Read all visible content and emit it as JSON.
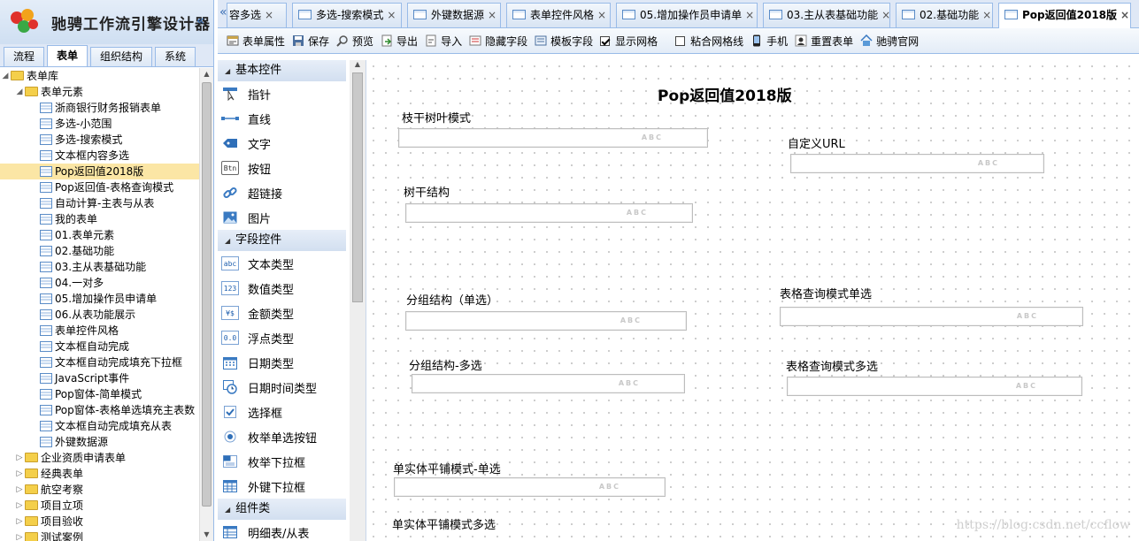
{
  "app": {
    "title": "驰骋工作流引擎设计器",
    "collapse_icon": "«"
  },
  "left_tabs": [
    {
      "label": "流程",
      "active": false
    },
    {
      "label": "表单",
      "active": true
    },
    {
      "label": "组织结构",
      "active": false
    },
    {
      "label": "系统",
      "active": false
    }
  ],
  "tree": {
    "root": "表单库",
    "group": "表单元素",
    "forms": [
      "浙商银行财务报销表单",
      "多选-小范围",
      "多选-搜索模式",
      "文本框内容多选",
      "Pop返回值2018版",
      "Pop返回值-表格查询模式",
      "自动计算-主表与从表",
      "我的表单",
      "01.表单元素",
      "02.基础功能",
      "03.主从表基础功能",
      "04.一对多",
      "05.增加操作员申请单",
      "06.从表功能展示",
      "表单控件风格",
      "文本框自动完成",
      "文本框自动完成填充下拉框",
      "JavaScript事件",
      "Pop窗体-简单模式",
      "Pop窗体-表格单选填充主表数",
      "文本框自动完成填充从表",
      "外键数据源"
    ],
    "selected": "Pop返回值2018版",
    "folders": [
      "企业资质申请表单",
      "经典表单",
      "航空考察",
      "项目立项",
      "项目验收",
      "测试案例"
    ]
  },
  "doc_tabs": [
    {
      "label": "容多选",
      "active": false
    },
    {
      "label": "多选-搜索模式",
      "active": false
    },
    {
      "label": "外键数据源",
      "active": false
    },
    {
      "label": "表单控件风格",
      "active": false
    },
    {
      "label": "05.增加操作员申请单",
      "active": false
    },
    {
      "label": "03.主从表基础功能",
      "active": false
    },
    {
      "label": "02.基础功能",
      "active": false
    },
    {
      "label": "Pop返回值2018版",
      "active": true
    }
  ],
  "toolbar": {
    "form_props": "表单属性",
    "save": "保存",
    "preview": "预览",
    "export": "导出",
    "import": "导入",
    "hidden_fields": "隐藏字段",
    "template_fields": "模板字段",
    "show_grid": "显示网格",
    "snap_grid": "粘合网格线",
    "mobile": "手机",
    "reset_form": "重置表单",
    "official_site": "驰骋官网",
    "show_grid_checked": true,
    "snap_grid_checked": false
  },
  "palette": {
    "basic_title": "基本控件",
    "basic": [
      "指针",
      "直线",
      "文字",
      "按钮",
      "超链接",
      "图片"
    ],
    "field_title": "字段控件",
    "field": [
      "文本类型",
      "数值类型",
      "金额类型",
      "浮点类型",
      "日期类型",
      "日期时间类型",
      "选择框",
      "枚举单选按钮",
      "枚举下拉框",
      "外键下拉框"
    ],
    "component_title": "组件类",
    "component": [
      "明细表/从表"
    ],
    "icon_text": {
      "btn": "Btn",
      "abc": "abc",
      "num": "123",
      "money": "¥$",
      "float": "0.0"
    }
  },
  "form": {
    "title": "Pop返回值2018版",
    "placeholder": "ABC",
    "labels": {
      "branch_leaf": "枝干树叶模式",
      "custom_url": "自定义URL",
      "tree_struct": "树干结构",
      "group_single": "分组结构（单选）",
      "table_single": "表格查询模式单选",
      "group_multi": "分组结构-多选",
      "table_multi": "表格查询模式多选",
      "flat_single": "单实体平铺模式-单选",
      "flat_multi": "单实体平铺模式多选"
    }
  },
  "watermark": "https://blog.csdn.net/ccflow"
}
